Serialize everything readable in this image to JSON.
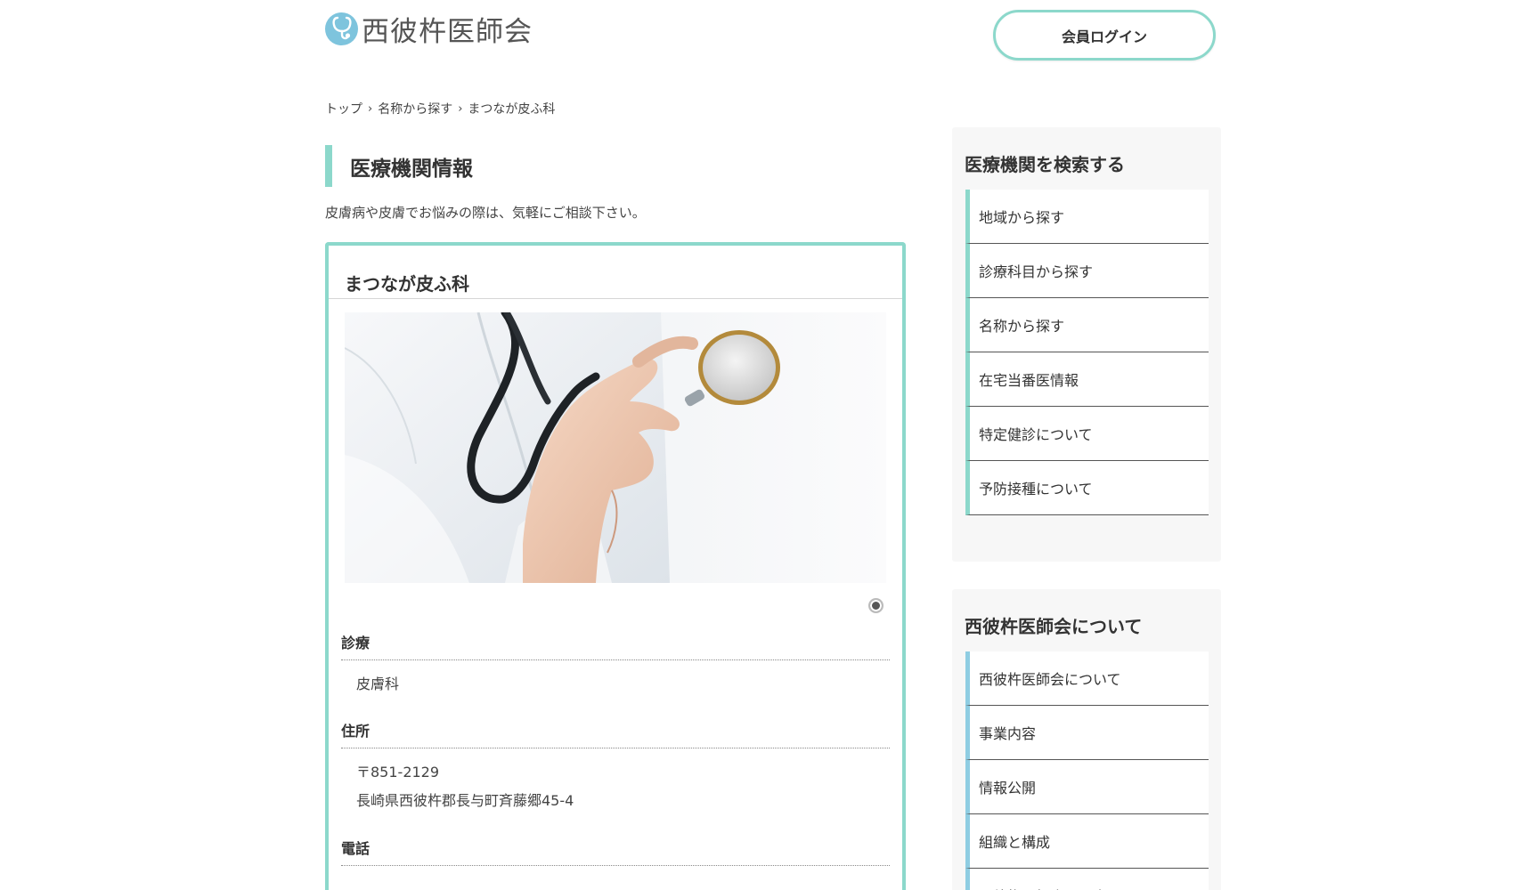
{
  "header": {
    "logo_text": "西彼杵医師会",
    "login_label": "会員ログイン"
  },
  "breadcrumb": {
    "items": [
      "トップ",
      "名称から探す",
      "まつなが皮ふ科"
    ],
    "separator": "›"
  },
  "main": {
    "section_title": "医療機関情報",
    "intro": "皮膚病や皮膚でお悩みの際は、気軽にご相談下さい。",
    "clinic_name": "まつなが皮ふ科",
    "fields": [
      {
        "label": "診療",
        "values": [
          "皮膚科"
        ]
      },
      {
        "label": "住所",
        "values": [
          "〒851-2129",
          "長崎県西彼杵郡長与町斉藤郷45-4"
        ]
      },
      {
        "label": "電話",
        "values": []
      }
    ]
  },
  "sidebar": {
    "search": {
      "title": "医療機関を検索する",
      "items": [
        "地域から探す",
        "診療科目から探す",
        "名称から探す",
        "在宅当番医情報",
        "特定健診について",
        "予防接種について"
      ]
    },
    "about": {
      "title": "西彼杵医師会について",
      "items": [
        "西彼杵医師会について",
        "事業内容",
        "情報公開",
        "組織と構成",
        "西彼杵医師会の歴史"
      ]
    }
  },
  "colors": {
    "accent_mint": "#8cd8cb",
    "accent_blue": "#8fcde2",
    "logo_blue": "#7ec4dd"
  },
  "icons": {
    "logo": "stethoscope-icon",
    "slider_indicator": "slide-dot-icon"
  }
}
